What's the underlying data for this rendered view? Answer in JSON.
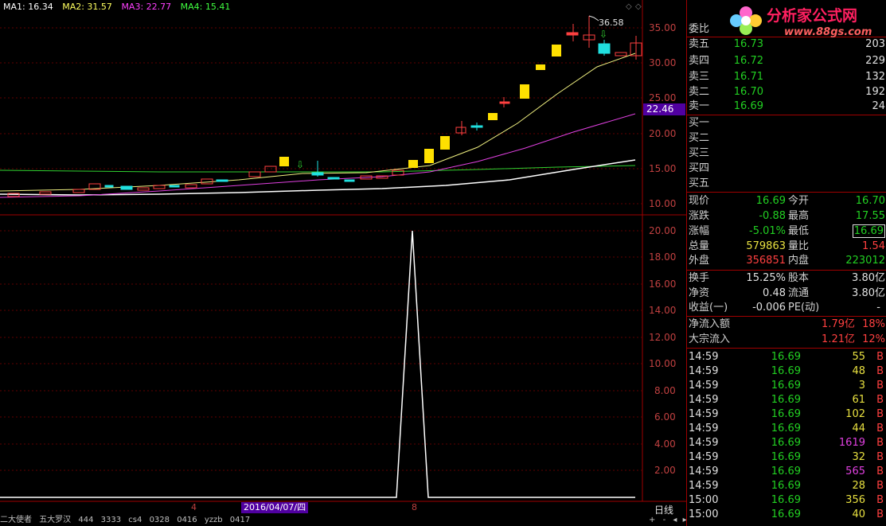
{
  "ma_legend": [
    {
      "label": "MA1: 16.34",
      "color": "#ffffff"
    },
    {
      "label": "MA2: 31.57",
      "color": "#ffff60"
    },
    {
      "label": "MA3: 22.77",
      "color": "#ff40ff"
    },
    {
      "label": "MA4: 15.41",
      "color": "#40ff40"
    }
  ],
  "price_axis": [
    "35.00",
    "30.00",
    "25.00",
    "20.00",
    "15.00",
    "10.00"
  ],
  "current_price_tag": "22.46",
  "high_label": "36.58",
  "volume_axis": [
    "20.00",
    "18.00",
    "16.00",
    "14.00",
    "12.00",
    "10.00",
    "8.00",
    "6.00",
    "4.00",
    "2.00"
  ],
  "date_axis": {
    "tick1": "4",
    "cursor_date": "2016/04/07/四",
    "tick2": "8"
  },
  "period_button": "日线",
  "bottom_tabs": [
    "二大使者",
    "五大罗汉",
    "444",
    "3333",
    "cs4",
    "0328",
    "0416",
    "yzzb",
    "0417"
  ],
  "bottom_controls": {
    "plus": "+",
    "minus": "-",
    "left": "◂",
    "right": "▸"
  },
  "logo": {
    "text": "分析家公式网",
    "url": "www.88gs.com"
  },
  "panel": {
    "weibi_label": "委比",
    "sells": [
      {
        "label": "卖五",
        "price": "16.73",
        "vol": "203"
      },
      {
        "label": "卖四",
        "price": "16.72",
        "vol": "229"
      },
      {
        "label": "卖三",
        "price": "16.71",
        "vol": "132"
      },
      {
        "label": "卖二",
        "price": "16.70",
        "vol": "192"
      },
      {
        "label": "卖一",
        "price": "16.69",
        "vol": "24"
      }
    ],
    "buys": [
      "买一",
      "买二",
      "买三",
      "买四",
      "买五"
    ],
    "quote": [
      {
        "l1": "现价",
        "v1": "16.69",
        "c1": "g",
        "l2": "今开",
        "v2": "16.70",
        "c2": "g"
      },
      {
        "l1": "涨跌",
        "v1": "-0.88",
        "c1": "g",
        "l2": "最高",
        "v2": "17.55",
        "c2": "g"
      },
      {
        "l1": "涨幅",
        "v1": "-5.01%",
        "c1": "g",
        "l2": "最低",
        "v2": "16.69",
        "c2": "g"
      },
      {
        "l1": "总量",
        "v1": "579863",
        "c1": "y",
        "l2": "量比",
        "v2": "1.54",
        "c2": "r"
      },
      {
        "l1": "外盘",
        "v1": "356851",
        "c1": "r",
        "l2": "内盘",
        "v2": "223012",
        "c2": "g"
      }
    ],
    "fund": [
      {
        "l1": "换手",
        "v1": "15.25%",
        "l2": "股本",
        "v2": "3.80亿"
      },
      {
        "l1": "净资",
        "v1": "0.48",
        "l2": "流通",
        "v2": "3.80亿"
      },
      {
        "l1": "收益(一)",
        "v1": "-0.006",
        "l2": "PE(动)",
        "v2": "-"
      }
    ],
    "flow": [
      {
        "label": "净流入额",
        "val": "1.79亿",
        "pct": "18%"
      },
      {
        "label": "大宗流入",
        "val": "1.21亿",
        "pct": "12%"
      }
    ],
    "ticks": [
      {
        "t": "14:59",
        "p": "16.69",
        "v": "55",
        "vc": "y",
        "d": "B"
      },
      {
        "t": "14:59",
        "p": "16.69",
        "v": "48",
        "vc": "y",
        "d": "B"
      },
      {
        "t": "14:59",
        "p": "16.69",
        "v": "3",
        "vc": "y",
        "d": "B"
      },
      {
        "t": "14:59",
        "p": "16.69",
        "v": "61",
        "vc": "y",
        "d": "B"
      },
      {
        "t": "14:59",
        "p": "16.69",
        "v": "102",
        "vc": "y",
        "d": "B"
      },
      {
        "t": "14:59",
        "p": "16.69",
        "v": "44",
        "vc": "y",
        "d": "B"
      },
      {
        "t": "14:59",
        "p": "16.69",
        "v": "1619",
        "vc": "m",
        "d": "B"
      },
      {
        "t": "14:59",
        "p": "16.69",
        "v": "32",
        "vc": "y",
        "d": "B"
      },
      {
        "t": "14:59",
        "p": "16.69",
        "v": "565",
        "vc": "m",
        "d": "B"
      },
      {
        "t": "14:59",
        "p": "16.69",
        "v": "28",
        "vc": "y",
        "d": "B"
      },
      {
        "t": "15:00",
        "p": "16.69",
        "v": "356",
        "vc": "y",
        "d": "B"
      },
      {
        "t": "15:00",
        "p": "16.69",
        "v": "40",
        "vc": "y",
        "d": "B"
      }
    ]
  }
}
